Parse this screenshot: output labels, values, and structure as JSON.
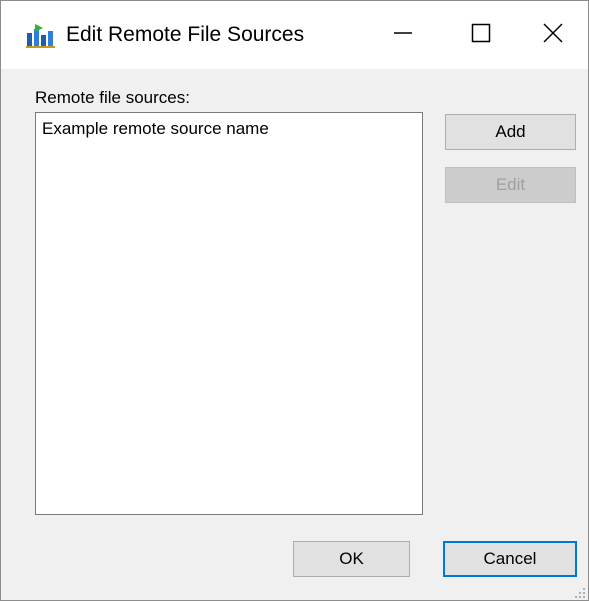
{
  "window": {
    "title": "Edit Remote File Sources",
    "icon": "app-chart-icon"
  },
  "controls": {
    "minimize": "minimize-icon",
    "maximize": "maximize-icon",
    "close": "close-icon"
  },
  "list": {
    "label": "Remote file sources:",
    "items": [
      "Example remote source name"
    ]
  },
  "buttons": {
    "add": "Add",
    "edit": "Edit",
    "ok": "OK",
    "cancel": "Cancel"
  },
  "colors": {
    "accent": "#0078d7",
    "dialog_bg": "#f0f0f0",
    "button_bg": "#e1e1e1",
    "disabled_text": "#a0a0a0"
  }
}
